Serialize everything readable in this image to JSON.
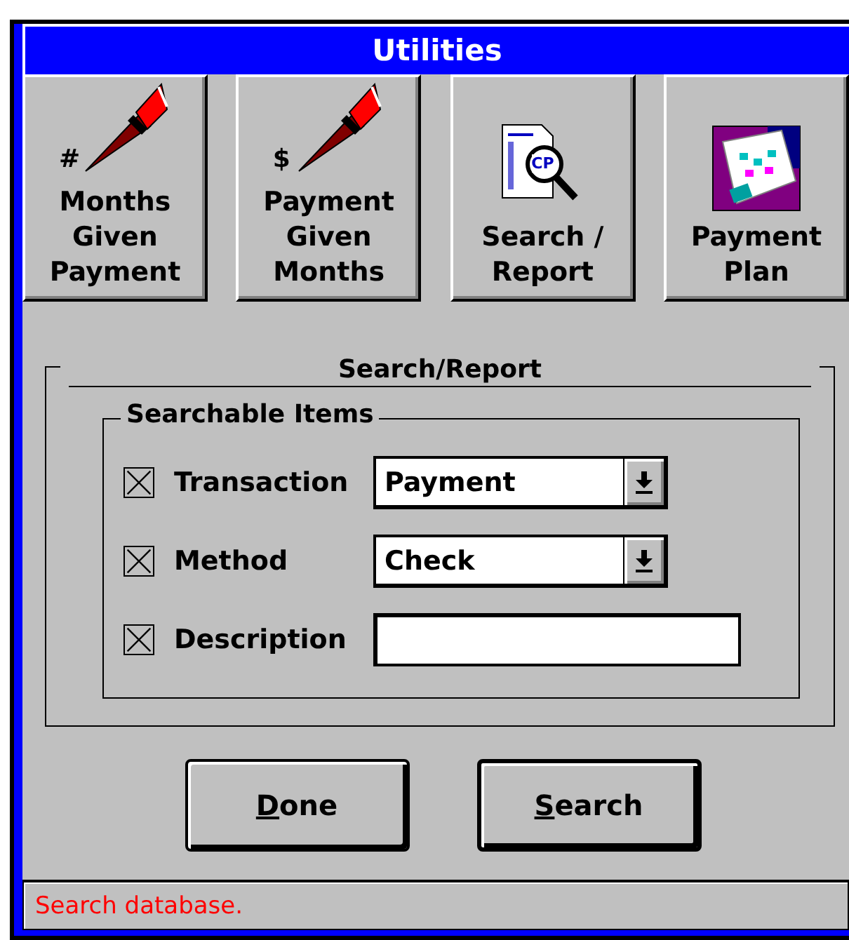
{
  "window": {
    "title": "Utilities"
  },
  "toolbar": [
    {
      "kind": "pen",
      "symbol": "#",
      "label": "Months Given Payment"
    },
    {
      "kind": "pen",
      "symbol": "$",
      "label": "Payment Given Months"
    },
    {
      "kind": "search",
      "symbol": "CP",
      "label": "Search / Report"
    },
    {
      "kind": "plan",
      "label": "Payment Plan"
    }
  ],
  "panel": {
    "title": "Search/Report",
    "group": "Searchable Items",
    "items": [
      {
        "kind": "dropdown",
        "label": "Transaction",
        "checked": true,
        "value": "Payment"
      },
      {
        "kind": "dropdown",
        "label": "Method",
        "checked": true,
        "value": "Check"
      },
      {
        "kind": "text",
        "label": "Description",
        "checked": true
      }
    ]
  },
  "buttons": [
    {
      "label": "Done",
      "default": false
    },
    {
      "label": "Search",
      "default": true
    }
  ],
  "status_bar": "Search database."
}
